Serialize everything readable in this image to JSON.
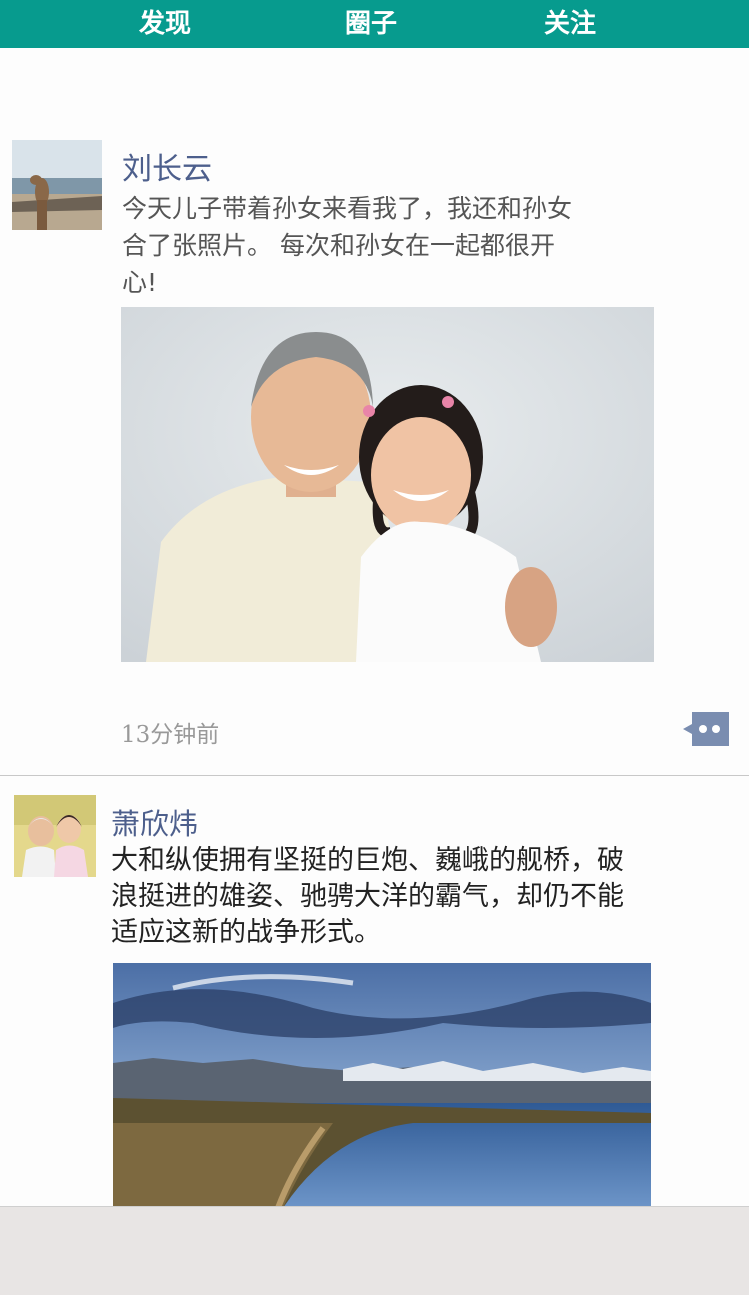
{
  "tabs": [
    {
      "label": "发现"
    },
    {
      "label": "圈子"
    },
    {
      "label": "关注"
    }
  ],
  "posts": [
    {
      "user": "刘长云",
      "text": "今天儿子带着孙女来看我了，我还和孙女\n合了张照片。      每次和孙女在一起都很开\n心!",
      "time": "13分钟前"
    },
    {
      "user": "萧欣炜",
      "text": "大和纵使拥有坚挺的巨炮、巍峨的舰桥，破\n浪挺进的雄姿、驰骋大洋的霸气，却仍不能\n适应这新的战争形式。"
    }
  ],
  "colors": {
    "header": "#079b8e",
    "username": "#4d5f8c",
    "comment_icon": "#7a8db0",
    "bottom_bar": "#e8e5e4"
  },
  "icons": {
    "comment": "comment-bubble-icon"
  }
}
